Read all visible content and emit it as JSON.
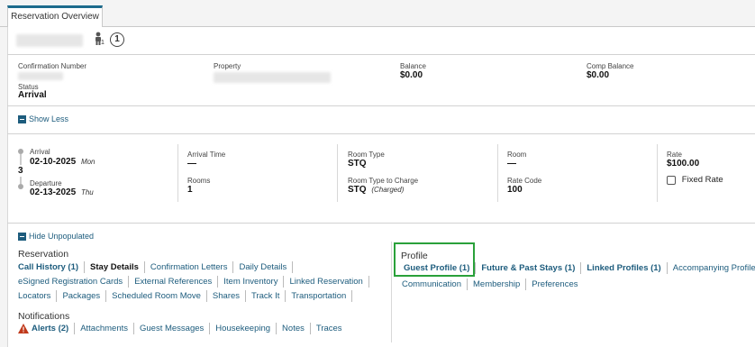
{
  "tab": {
    "label": "Reservation Overview"
  },
  "header": {
    "person_count": "1",
    "info_number": "1"
  },
  "summary": {
    "confirmation_label": "Confirmation Number",
    "property_label": "Property",
    "balance_label": "Balance",
    "balance_value": "$0.00",
    "comp_balance_label": "Comp Balance",
    "comp_balance_value": "$0.00",
    "status_label": "Status",
    "status_value": "Arrival"
  },
  "show_less": "Show Less",
  "stay": {
    "count": "3",
    "arrival_label": "Arrival",
    "arrival_date": "02-10-2025",
    "arrival_day": "Mon",
    "departure_label": "Departure",
    "departure_date": "02-13-2025",
    "departure_day": "Thu",
    "arrival_time_label": "Arrival Time",
    "arrival_time_value": "—",
    "rooms_label": "Rooms",
    "rooms_value": "1",
    "room_type_label": "Room Type",
    "room_type_value": "STQ",
    "room_type_charge_label": "Room Type to Charge",
    "room_type_charge_value": "STQ",
    "room_type_charge_note": "(Charged)",
    "room_label": "Room",
    "room_value": "—",
    "rate_code_label": "Rate Code",
    "rate_code_value": "100",
    "rate_label": "Rate",
    "rate_value": "$100.00",
    "fixed_rate_label": "Fixed Rate"
  },
  "hide_unpopulated": "Hide Unpopulated",
  "reservation": {
    "heading": "Reservation",
    "row1": [
      "Call History (1)",
      "Stay Details",
      "Confirmation Letters",
      "Daily Details"
    ],
    "row2": [
      "eSigned Registration Cards",
      "External References",
      "Item Inventory",
      "Linked Reservation"
    ],
    "row3": [
      "Locators",
      "Packages",
      "Scheduled Room Move",
      "Shares",
      "Track It",
      "Transportation"
    ]
  },
  "notifications": {
    "heading": "Notifications",
    "items": [
      "Alerts (2)",
      "Attachments",
      "Guest Messages",
      "Housekeeping",
      "Notes",
      "Traces"
    ]
  },
  "profile": {
    "heading": "Profile",
    "row1": [
      "Guest Profile (1)",
      "Future & Past Stays (1)",
      "Linked Profiles (1)",
      "Accompanying Profiles"
    ],
    "row2": [
      "Communication",
      "Membership",
      "Preferences"
    ]
  },
  "colors": {
    "link": "#1d5c7d",
    "tab_accent": "#1d6b8c",
    "highlight": "#2aa13a",
    "alert": "#c0391b"
  }
}
